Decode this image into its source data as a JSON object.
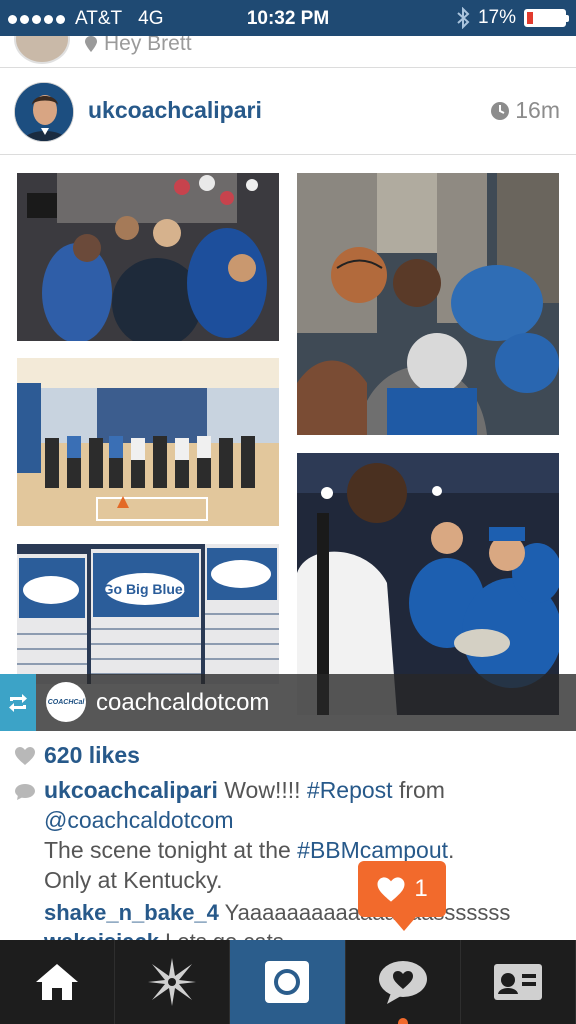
{
  "status_bar": {
    "carrier": "AT&T",
    "network": "4G",
    "time": "10:32 PM",
    "battery_percent": "17%",
    "battery_level": 0.17
  },
  "previous_post": {
    "location": "Hey Brett"
  },
  "post": {
    "username": "ukcoachcalipari",
    "time_ago": "16m",
    "photo_pizza_box_text": "Go Big Blue!",
    "repost_avatar_text": "COACHCal",
    "repost_user": "coachcaldotcom",
    "likes": "620 likes",
    "caption": {
      "username": "ukcoachcalipari",
      "text_1": "Wow!!!!",
      "tag_1": "#Repost",
      "text_2": "from",
      "mention": "@coachcaldotcom",
      "text_3": "The scene tonight at the",
      "tag_2": "#BBMcampout",
      "text_4": ".",
      "text_5": "Only at Kentucky."
    },
    "comments": [
      {
        "username": "shake_n_bake_4",
        "text": "Yaaaaaaaaaaaaaaaasssssss"
      },
      {
        "username": "wakeisjack",
        "text": "Lets go cats.........."
      }
    ]
  },
  "notification": {
    "count": "1",
    "color": "#f26a2c"
  },
  "tab_bar": {
    "tabs": [
      {
        "icon": "home-icon"
      },
      {
        "icon": "explore-star-icon"
      },
      {
        "icon": "camera-icon"
      },
      {
        "icon": "activity-bubble-icon"
      },
      {
        "icon": "profile-card-icon"
      }
    ],
    "active_color": "#2b5d8c"
  }
}
